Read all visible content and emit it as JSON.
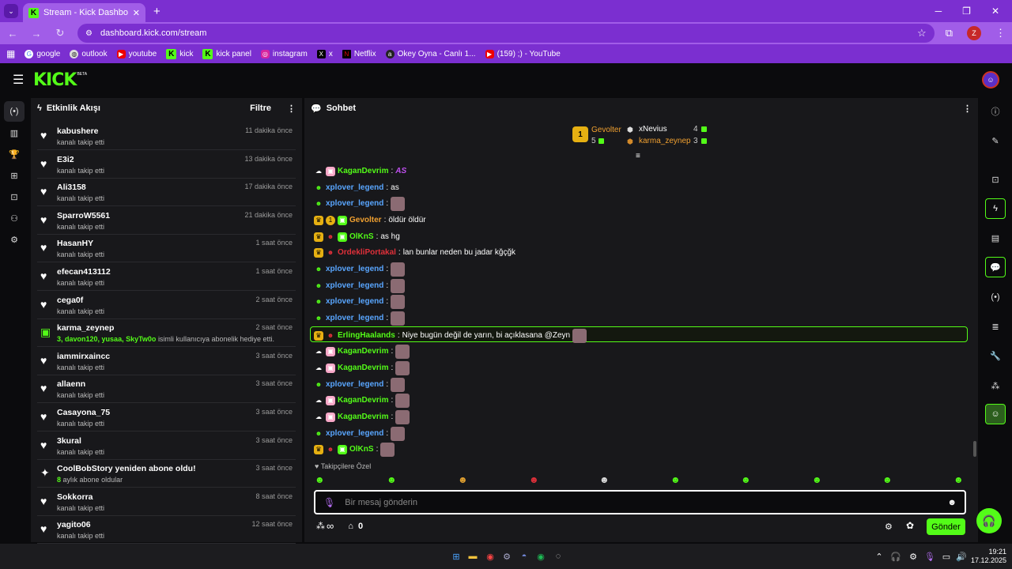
{
  "browser": {
    "tab_title": "Stream - Kick Dashboard",
    "url": "dashboard.kick.com/stream",
    "profile_initial": "Z",
    "bookmarks": [
      "google",
      "outlook",
      "youtube",
      "kick",
      "kick panel",
      "instagram",
      "x",
      "Netflix",
      "Okey Oyna - Canlı 1...",
      "(159) ;) - YouTube"
    ]
  },
  "kick": {
    "logo": "KICK",
    "beta": "BETA"
  },
  "activity": {
    "title": "Etkinlik Akışı",
    "filter_label": "Filtre",
    "items": [
      {
        "name": "kabushere",
        "sub": "kanalı takip etti",
        "time": "11 dakika önce"
      },
      {
        "name": "E3i2",
        "sub": "kanalı takip etti",
        "time": "13 dakika önce"
      },
      {
        "name": "Ali3158",
        "sub": "kanalı takip etti",
        "time": "17 dakika önce"
      },
      {
        "name": "SparroW5561",
        "sub": "kanalı takip etti",
        "time": "21 dakika önce"
      },
      {
        "name": "HasanHY",
        "sub": "kanalı takip etti",
        "time": "1 saat önce"
      },
      {
        "name": "efecan413112",
        "sub": "kanalı takip etti",
        "time": "1 saat önce"
      },
      {
        "name": "cega0f",
        "sub": "kanalı takip etti",
        "time": "2 saat önce"
      },
      {
        "name": "karma_zeynep",
        "sub_count": "3,",
        "sub_users": "davon120, yusaa, SkyTw0o",
        "sub_tail": "isimli kullanıcıya abonelik hediye etti.",
        "time": "2 saat önce"
      },
      {
        "name": "iammirxaincc",
        "sub": "kanalı takip etti",
        "time": "3 saat önce"
      },
      {
        "name": "allaenn",
        "sub": "kanalı takip etti",
        "time": "3 saat önce"
      },
      {
        "name": "Casayona_75",
        "sub": "kanalı takip etti",
        "time": "3 saat önce"
      },
      {
        "name": "3kural",
        "sub": "kanalı takip etti",
        "time": "3 saat önce"
      },
      {
        "name": "CoolBobStory yeniden abone oldu!",
        "sub_count": "8",
        "sub_tail": "aylık abone oldular",
        "time": "3 saat önce"
      },
      {
        "name": "Sokkorra",
        "sub": "kanalı takip etti",
        "time": "8 saat önce"
      },
      {
        "name": "yagito06",
        "sub": "kanalı takip etti",
        "time": "12 saat önce"
      }
    ]
  },
  "chat": {
    "title": "Sohbet",
    "gifters": {
      "first": {
        "rank": "1",
        "name": "Gevolter",
        "count": "5"
      },
      "second": {
        "name": "xNevius",
        "count": "4"
      },
      "third": {
        "name": "karma_zeynep",
        "count": "3"
      }
    },
    "messages": [
      {
        "user": "KaganDevrim",
        "color": "#53fc18",
        "text": "",
        "emote": "AS"
      },
      {
        "user": "xplover_legend",
        "color": "#59a6ff",
        "text": "as"
      },
      {
        "user": "xplover_legend",
        "color": "#59a6ff",
        "text": ""
      },
      {
        "user": "Gevolter",
        "color": "#f0a030",
        "text": "öldür öldür"
      },
      {
        "user": "OlKnS",
        "color": "#53fc18",
        "text": "as hg"
      },
      {
        "user": "OrdekliPortakal",
        "color": "#e0303a",
        "text": "lan bunlar neden bu jadar kğçğk"
      },
      {
        "user": "xplover_legend",
        "color": "#59a6ff",
        "text": ""
      },
      {
        "user": "xplover_legend",
        "color": "#59a6ff",
        "text": ""
      },
      {
        "user": "xplover_legend",
        "color": "#59a6ff",
        "text": ""
      },
      {
        "user": "xplover_legend",
        "color": "#59a6ff",
        "text": ""
      },
      {
        "user": "ErlingHaalands",
        "color": "#53fc18",
        "text": "Niye bugün değil de yarın, bi açıklasana @Zeyn"
      },
      {
        "user": "KaganDevrim",
        "color": "#53fc18",
        "text": ""
      },
      {
        "user": "KaganDevrim",
        "color": "#53fc18",
        "text": ""
      },
      {
        "user": "xplover_legend",
        "color": "#59a6ff",
        "text": ""
      },
      {
        "user": "KaganDevrim",
        "color": "#53fc18",
        "text": ""
      },
      {
        "user": "KaganDevrim",
        "color": "#53fc18",
        "text": ""
      },
      {
        "user": "xplover_legend",
        "color": "#59a6ff",
        "text": ""
      },
      {
        "user": "OlKnS",
        "color": "#53fc18",
        "text": ""
      }
    ],
    "emote_tab_label": "Takipçilere Özel",
    "input_placeholder": "Bir mesaj gönderin",
    "infinity_label": "∞",
    "count_label": "0",
    "send_label": "Gönder"
  },
  "taskbar": {
    "time": "19:21",
    "date": "17.12.2025"
  }
}
